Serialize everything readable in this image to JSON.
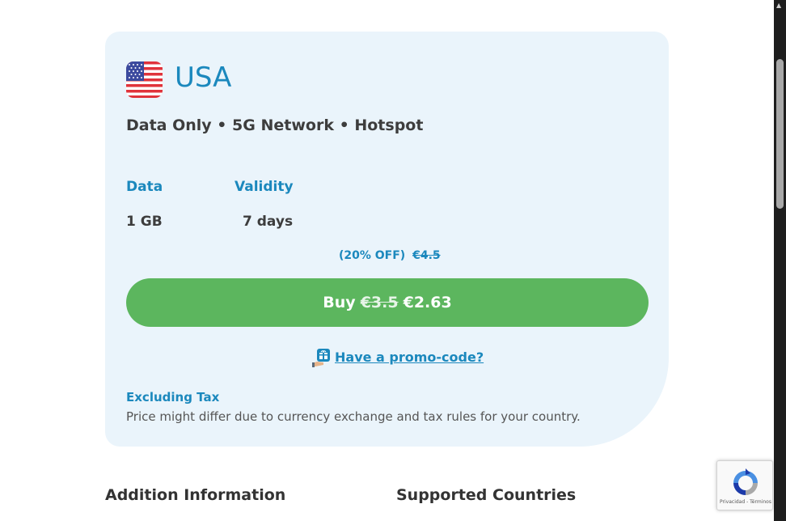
{
  "plan": {
    "country": "USA",
    "features": "Data Only • 5G Network • Hotspot",
    "data_label": "Data",
    "data_value": "1 GB",
    "validity_label": "Validity",
    "validity_value": "7 days",
    "discount_text": "(20% OFF)",
    "original_price": "€4.5",
    "buy_label": "Buy",
    "buy_old_price": "€3.5",
    "buy_price": "€2.63",
    "promo_link": "Have a promo-code?",
    "tax_title": "Excluding Tax",
    "tax_note": "Price might differ due to currency exchange and tax rules for your country."
  },
  "sections": {
    "additional_info": "Addition Information",
    "supported_countries": "Supported Countries"
  },
  "recaptcha": {
    "text": "Privacidad - Términos"
  },
  "icons": {
    "flag": "usa-flag-icon",
    "promo": "gift-hand-icon",
    "recaptcha": "recaptcha-icon"
  },
  "colors": {
    "accent": "#1b88bd",
    "buy_button": "#5cb65e",
    "card_bg": "#eaf4fb"
  }
}
